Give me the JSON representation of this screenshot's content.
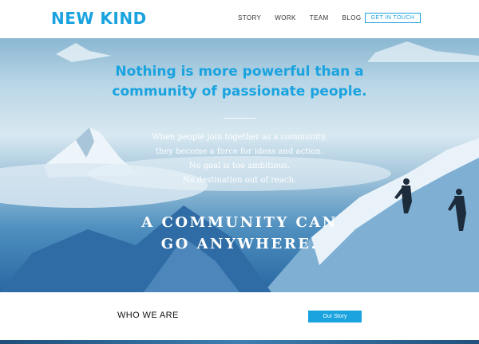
{
  "brand": {
    "logo_text": "NEW KIND"
  },
  "nav": {
    "links": [
      "STORY",
      "WORK",
      "TEAM",
      "BLOG"
    ],
    "cta_label": "GET IN TOUCH"
  },
  "hero": {
    "headline_line1": "Nothing is more powerful than a",
    "headline_line2": "community of passionate people.",
    "body_lines": [
      "When people join together as a community,",
      "they become a force for ideas and action.",
      "No goal is too ambitious.",
      "No destination out of reach."
    ],
    "tagline_line1": "A COMMUNITY CAN",
    "tagline_line2": "GO ANYWHERE."
  },
  "about": {
    "title": "WHO WE ARE",
    "button_label": "Our Story"
  },
  "colors": {
    "accent": "#1aa3df",
    "hero_text": "#ffffff",
    "body_text": "#111111"
  }
}
